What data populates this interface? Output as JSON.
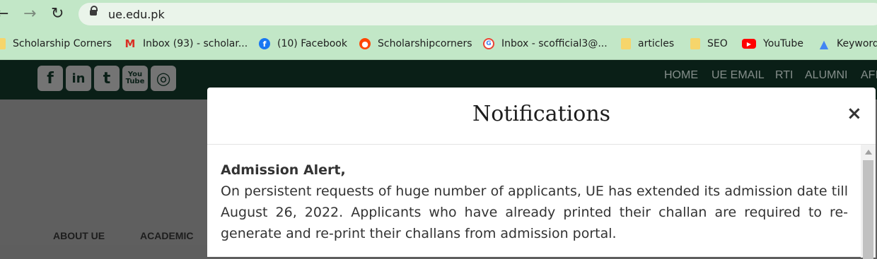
{
  "browser": {
    "url": "ue.edu.pk",
    "nav": {
      "back": "←",
      "forward": "→",
      "reload": "↻"
    }
  },
  "bookmarks": [
    {
      "label": "Scholarship Corners",
      "icon": "folder-icon"
    },
    {
      "label": "Inbox (93) - scholar...",
      "icon": "gmail-icon"
    },
    {
      "label": "(10) Facebook",
      "icon": "facebook-icon"
    },
    {
      "label": "Scholarshipcorners",
      "icon": "reddit-icon"
    },
    {
      "label": "Inbox - scofficial3@...",
      "icon": "google-icon"
    },
    {
      "label": "articles",
      "icon": "folder-icon"
    },
    {
      "label": "SEO",
      "icon": "folder-icon"
    },
    {
      "label": "YouTube",
      "icon": "youtube-icon"
    },
    {
      "label": "Keyword",
      "icon": "google-ads-icon"
    }
  ],
  "site": {
    "social_icons": [
      {
        "name": "facebook-icon",
        "glyph": "f"
      },
      {
        "name": "linkedin-icon",
        "glyph": "in"
      },
      {
        "name": "twitter-icon",
        "glyph": "t"
      },
      {
        "name": "youtube-icon",
        "glyph": "You Tube"
      },
      {
        "name": "instagram-icon",
        "glyph": "◎"
      }
    ],
    "top_nav": [
      "HOME",
      "UE EMAIL",
      "RTI",
      "ALUMNI",
      "AFI"
    ],
    "main_nav": [
      "ABOUT UE",
      "ACADEMIC"
    ]
  },
  "modal": {
    "title": "Notifications",
    "close": "×",
    "alert_title": "Admission Alert,",
    "alert_text": "On persistent requests of huge number of applicants, UE has extended its admission date till August 26, 2022. Applicants who have already printed their challan are required to re-generate and re-print their challans from admission portal."
  },
  "colors": {
    "browser_bar": "#c2e7c7",
    "site_header": "#0a1f17",
    "overlay": "#5f5f5f",
    "modal_bg": "#ffffff"
  }
}
